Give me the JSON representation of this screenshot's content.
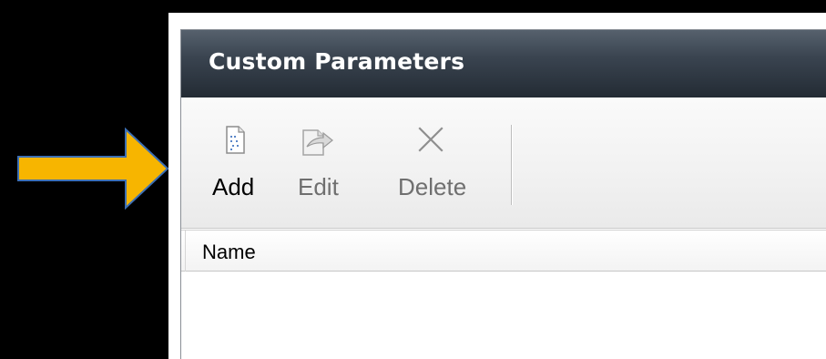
{
  "panel": {
    "title": "Custom Parameters"
  },
  "toolbar": {
    "add_label": "Add",
    "edit_label": "Edit",
    "delete_label": "Delete"
  },
  "grid": {
    "columns": [
      "Name"
    ],
    "rows": []
  },
  "icons": {
    "add": "new-document-icon",
    "edit": "edit-document-icon",
    "delete": "delete-x-icon",
    "pointer": "arrow-right-icon"
  },
  "colors": {
    "arrow_fill": "#f7b500",
    "titlebar": "#2f3944",
    "disabled_text": "#6f6f6f"
  }
}
